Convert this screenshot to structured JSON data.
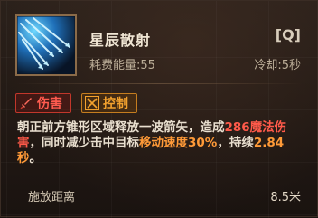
{
  "skill": {
    "name": "星辰散射",
    "hotkey": "[Q]",
    "cost_text": "耗费能量:55",
    "cooldown_text": "冷却:5秒",
    "icon": "arrow-volley-icon"
  },
  "tags": [
    {
      "label": "伤害",
      "icon": "sword-icon",
      "color": "#ff5b4f"
    },
    {
      "label": "控制",
      "icon": "crossed-arrows-icon",
      "color": "#f2a12e"
    }
  ],
  "description": {
    "p1": "朝正前方锥形区域释放一波箭矢，造成",
    "dmg": "286魔法伤害",
    "p2": "，同时减少击中目标",
    "slow": "移动速度30%",
    "p3": "，持续",
    "dur": "2.84秒",
    "p4": "。"
  },
  "stats": {
    "range_label": "施放距离",
    "range_value": "8.5米"
  },
  "colors": {
    "damage_highlight": "#ff5a4a",
    "slow_highlight": "#ff9a38",
    "frame_gold": "#8b6b49"
  }
}
